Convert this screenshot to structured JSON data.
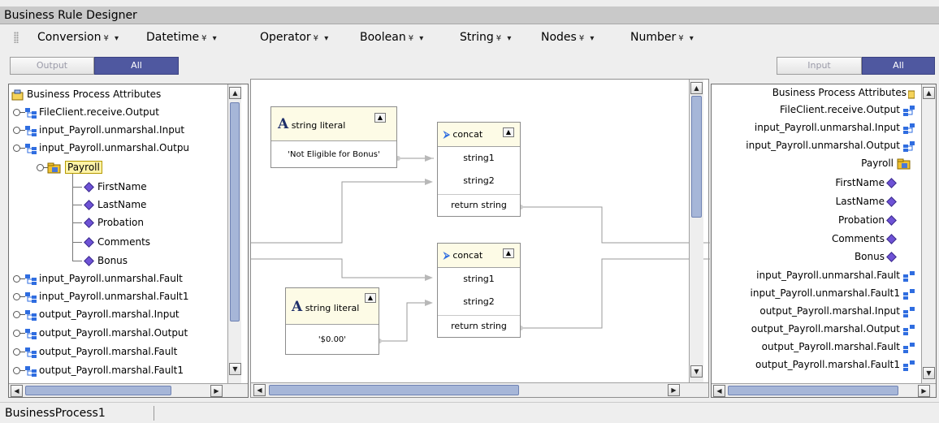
{
  "window": {
    "title": "Business Rule Designer"
  },
  "menu": {
    "items": [
      "Conversion",
      "Datetime",
      "Operator",
      "Boolean",
      "String",
      "Nodes",
      "Number"
    ],
    "dropdown_glyph": "¥ ▾"
  },
  "left_toggle": {
    "output_label": "Output",
    "all_label": "All",
    "active": "All"
  },
  "right_toggle": {
    "input_label": "Input",
    "all_label": "All",
    "active": "All"
  },
  "left_tree": {
    "root": "Business Process Attributes",
    "items": [
      "FileClient.receive.Output",
      "input_Payroll.unmarshal.Input",
      "input_Payroll.unmarshal.Outpu",
      "Payroll",
      "FirstName",
      "LastName",
      "Probation",
      "Comments",
      "Bonus",
      "input_Payroll.unmarshal.Fault",
      "input_Payroll.unmarshal.Fault1",
      "output_Payroll.marshal.Input",
      "output_Payroll.marshal.Output",
      "output_Payroll.marshal.Fault",
      "output_Payroll.marshal.Fault1"
    ]
  },
  "right_tree": {
    "root": "Business Process Attributes",
    "items": [
      "FileClient.receive.Output",
      "input_Payroll.unmarshal.Input",
      "input_Payroll.unmarshal.Output",
      "Payroll",
      "FirstName",
      "LastName",
      "Probation",
      "Comments",
      "Bonus",
      "input_Payroll.unmarshal.Fault",
      "input_Payroll.unmarshal.Fault1",
      "output_Payroll.marshal.Input",
      "output_Payroll.marshal.Output",
      "output_Payroll.marshal.Fault",
      "output_Payroll.marshal.Fault1"
    ]
  },
  "canvas": {
    "literal1": {
      "title": "string literal",
      "value": "'Not Eligible for Bonus'"
    },
    "literal2": {
      "title": "string literal",
      "value": "'$0.00'"
    },
    "concat1": {
      "title": "concat",
      "in1": "string1",
      "in2": "string2",
      "out": "return string"
    },
    "concat2": {
      "title": "concat",
      "in1": "string1",
      "in2": "string2",
      "out": "return string"
    },
    "literal_glyph": "A"
  },
  "status": {
    "text": "BusinessProcess1"
  },
  "colors": {
    "accent": "#4f58a0",
    "diamond": "#6e52d6",
    "selection": "#fff3a8"
  }
}
